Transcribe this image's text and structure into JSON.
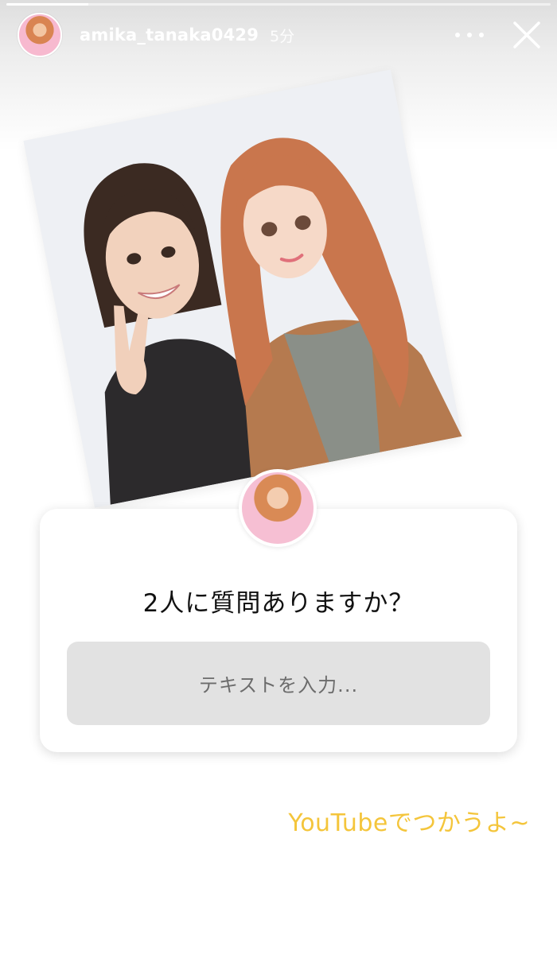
{
  "story": {
    "progress": 0.15,
    "username": "amika_tanaka0429",
    "time_ago": "5分",
    "more_icon": "more-horizontal-icon",
    "close_icon": "close-icon"
  },
  "question_sticker": {
    "question": "2人に質問ありますか？",
    "placeholder": "テキストを入力..."
  },
  "caption": "YouTubeでつかうよ~",
  "colors": {
    "caption": "#f4c53b",
    "answer_field_bg": "#e2e2e2",
    "sticker_bg": "#ffffff"
  }
}
